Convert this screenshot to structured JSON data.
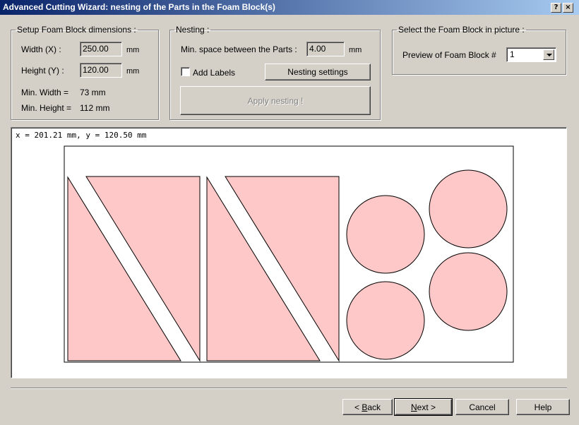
{
  "window": {
    "title": "Advanced Cutting Wizard: nesting of the Parts in the Foam Block(s)",
    "help_glyph": "?",
    "close_glyph": "×"
  },
  "setup": {
    "legend": "Setup Foam Block dimensions :",
    "width_label": "Width (X) :",
    "width_value": "250.00",
    "width_unit": "mm",
    "height_label": "Height (Y) :",
    "height_value": "120.00",
    "height_unit": "mm",
    "min_width_label": "Min. Width =",
    "min_width_value": "73 mm",
    "min_height_label": "Min. Height =",
    "min_height_value": "112 mm"
  },
  "nesting": {
    "legend": "Nesting :",
    "min_space_label": "Min. space between the Parts :",
    "min_space_value": "4.00",
    "min_space_unit": "mm",
    "add_labels": "Add Labels",
    "add_labels_checked": false,
    "settings_button": "Nesting settings",
    "apply_button": "Apply nesting !"
  },
  "select": {
    "legend": "Select the Foam Block in picture :",
    "preview_label": "Preview of Foam Block #",
    "preview_value": "1"
  },
  "preview": {
    "coords": "x = 201.21 mm, y = 120.50 mm",
    "part_color": "#ffc8c8"
  },
  "footer": {
    "back_prefix": "< ",
    "back_key": "B",
    "back_rest": "ack",
    "next_key": "N",
    "next_rest": "ext >",
    "cancel": "Cancel",
    "help": "Help"
  }
}
